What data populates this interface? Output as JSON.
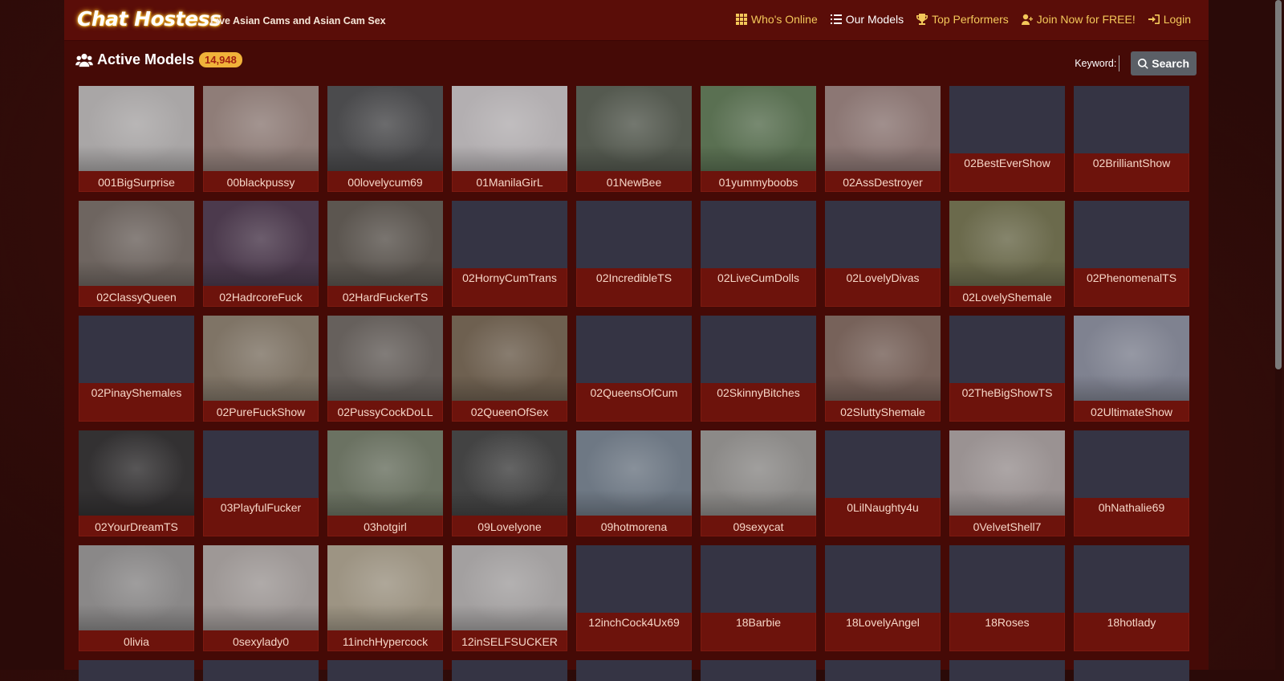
{
  "brand": "Chat Hostess",
  "tagline": "Live Asian Cams and Asian Cam Sex",
  "nav": [
    {
      "label": "Who's Online",
      "icon": "grid-icon",
      "name": "nav-whos-online",
      "active": false
    },
    {
      "label": "Our Models",
      "icon": "list-icon",
      "name": "nav-our-models",
      "active": true
    },
    {
      "label": "Top Performers",
      "icon": "trophy-icon",
      "name": "nav-top-performers",
      "active": false
    },
    {
      "label": "Join Now for FREE!",
      "icon": "user-plus-icon",
      "name": "nav-join-now",
      "active": false
    },
    {
      "label": "Login",
      "icon": "login-icon",
      "name": "nav-login",
      "active": false
    }
  ],
  "section": {
    "title": "Active Models",
    "count": "14,948"
  },
  "search": {
    "label": "Keyword:",
    "button": "Search",
    "value": ""
  },
  "models": [
    {
      "name": "001BigSurprise",
      "photo": true,
      "tone": "#a9a6a6"
    },
    {
      "name": "00blackpussy",
      "photo": true,
      "tone": "#8f7d78"
    },
    {
      "name": "00lovelycum69",
      "photo": true,
      "tone": "#4b4b4d"
    },
    {
      "name": "01ManilaGirL",
      "photo": true,
      "tone": "#b3afb1"
    },
    {
      "name": "01NewBee",
      "photo": true,
      "tone": "#555a50"
    },
    {
      "name": "01yummyboobs",
      "photo": true,
      "tone": "#5a7052"
    },
    {
      "name": "02AssDestroyer",
      "photo": true,
      "tone": "#8c7774"
    },
    {
      "name": "02BestEverShow",
      "photo": false,
      "tone": ""
    },
    {
      "name": "02BrilliantShow",
      "photo": false,
      "tone": ""
    },
    {
      "name": "02ClassyQueen",
      "photo": true,
      "tone": "#6e6560"
    },
    {
      "name": "02HadrcoreFuck",
      "photo": true,
      "tone": "#4c3a4d"
    },
    {
      "name": "02HardFuckerTS",
      "photo": true,
      "tone": "#5c5650"
    },
    {
      "name": "02HornyCumTrans",
      "photo": false,
      "tone": ""
    },
    {
      "name": "02IncredibleTS",
      "photo": false,
      "tone": ""
    },
    {
      "name": "02LiveCumDolls",
      "photo": false,
      "tone": ""
    },
    {
      "name": "02LovelyDivas",
      "photo": false,
      "tone": ""
    },
    {
      "name": "02LovelyShemale",
      "photo": true,
      "tone": "#6b6a4c"
    },
    {
      "name": "02PhenomenalTS",
      "photo": false,
      "tone": ""
    },
    {
      "name": "02PinayShemales",
      "photo": false,
      "tone": ""
    },
    {
      "name": "02PureFuckShow",
      "photo": true,
      "tone": "#7f7466"
    },
    {
      "name": "02PussyCockDoLL",
      "photo": true,
      "tone": "#66605c"
    },
    {
      "name": "02QueenOfSex",
      "photo": true,
      "tone": "#6e6050"
    },
    {
      "name": "02QueensOfCum",
      "photo": false,
      "tone": ""
    },
    {
      "name": "02SkinnyBitches",
      "photo": false,
      "tone": ""
    },
    {
      "name": "02SluttyShemale",
      "photo": true,
      "tone": "#77625a"
    },
    {
      "name": "02TheBigShowTS",
      "photo": false,
      "tone": ""
    },
    {
      "name": "02UltimateShow",
      "photo": true,
      "tone": "#7f8290"
    },
    {
      "name": "02YourDreamTS",
      "photo": true,
      "tone": "#333132"
    },
    {
      "name": "03PlayfulFucker",
      "photo": false,
      "tone": ""
    },
    {
      "name": "03hotgirl",
      "photo": true,
      "tone": "#6b7262"
    },
    {
      "name": "09Lovelyone",
      "photo": true,
      "tone": "#434343"
    },
    {
      "name": "09hotmorena",
      "photo": true,
      "tone": "#6e7884"
    },
    {
      "name": "09sexycat",
      "photo": true,
      "tone": "#8c8a88"
    },
    {
      "name": "0LilNaughty4u",
      "photo": false,
      "tone": ""
    },
    {
      "name": "0VelvetShell7",
      "photo": true,
      "tone": "#9a9292"
    },
    {
      "name": "0hNathalie69",
      "photo": false,
      "tone": ""
    },
    {
      "name": "0livia",
      "photo": true,
      "tone": "#8a8888"
    },
    {
      "name": "0sexylady0",
      "photo": true,
      "tone": "#9e9896"
    },
    {
      "name": "11inchHypercock",
      "photo": true,
      "tone": "#9d9483"
    },
    {
      "name": "12inSELFSUCKER",
      "photo": true,
      "tone": "#a3a0a0"
    },
    {
      "name": "12inchCock4Ux69",
      "photo": false,
      "tone": ""
    },
    {
      "name": "18Barbie",
      "photo": false,
      "tone": ""
    },
    {
      "name": "18LovelyAngel",
      "photo": false,
      "tone": ""
    },
    {
      "name": "18Roses",
      "photo": false,
      "tone": ""
    },
    {
      "name": "18hotlady",
      "photo": false,
      "tone": ""
    }
  ]
}
